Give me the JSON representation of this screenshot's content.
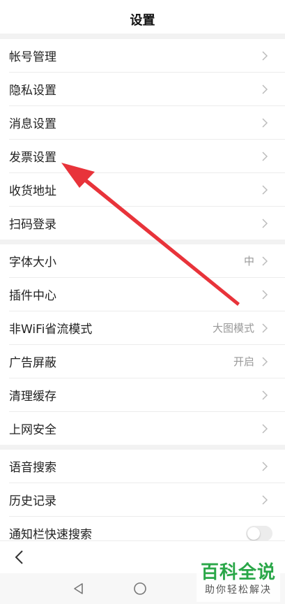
{
  "header": {
    "title": "设置"
  },
  "section1": {
    "items": [
      {
        "label": "帐号管理",
        "value": ""
      },
      {
        "label": "隐私设置",
        "value": ""
      },
      {
        "label": "消息设置",
        "value": ""
      },
      {
        "label": "发票设置",
        "value": ""
      },
      {
        "label": "收货地址",
        "value": ""
      },
      {
        "label": "扫码登录",
        "value": ""
      }
    ]
  },
  "section2": {
    "items": [
      {
        "label": "字体大小",
        "value": "中"
      },
      {
        "label": "插件中心",
        "value": ""
      },
      {
        "label": "非WiFi省流模式",
        "value": "大图模式"
      },
      {
        "label": "广告屏蔽",
        "value": "开启"
      },
      {
        "label": "清理缓存",
        "value": ""
      },
      {
        "label": "上网安全",
        "value": ""
      }
    ]
  },
  "section3": {
    "items": [
      {
        "label": "语音搜索",
        "value": ""
      },
      {
        "label": "历史记录",
        "value": ""
      },
      {
        "label": "通知栏快速搜索",
        "toggle_on": false
      }
    ]
  },
  "watermark": {
    "main": "百科全说",
    "sub": "助你轻松解决"
  },
  "colors": {
    "annotation_arrow": "#e8333a",
    "watermark_green": "#2aa748"
  }
}
